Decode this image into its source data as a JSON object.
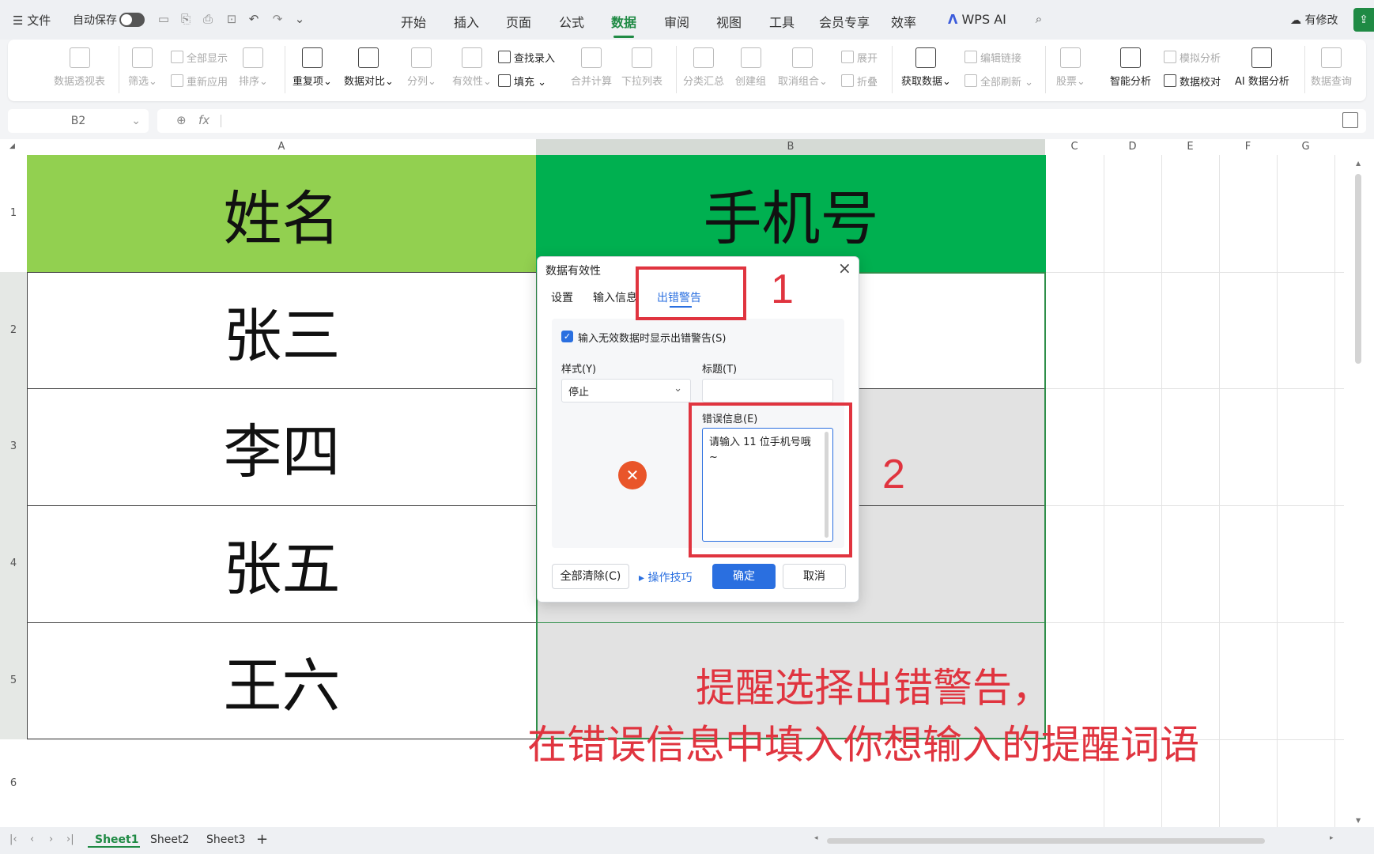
{
  "topbar": {
    "file_menu": "文件",
    "autosave_label": "自动保存",
    "menu_tabs": [
      "开始",
      "插入",
      "页面",
      "公式",
      "数据",
      "审阅",
      "视图",
      "工具",
      "会员专享",
      "效率",
      "WPS AI"
    ],
    "active_tab": "数据",
    "modify_label": "有修改"
  },
  "ribbon": {
    "pivot": "数据透视表",
    "filter": "筛选",
    "show_all": "全部显示",
    "reapply": "重新应用",
    "sort": "排序",
    "duplicates": "重复项",
    "compare": "数据对比",
    "split": "分列",
    "validity": "有效性",
    "find_entry": "查找录入",
    "fill": "填充",
    "consolidate": "合并计算",
    "dropdown": "下拉列表",
    "subtotal": "分类汇总",
    "group": "创建组",
    "ungroup": "取消组合",
    "expand": "展开",
    "collapse": "折叠",
    "get_data": "获取数据",
    "edit_links": "编辑链接",
    "refresh_all": "全部刷新",
    "stock": "股票",
    "what_if": "模拟分析",
    "smart_analysis": "智能分析",
    "data_check": "数据校对",
    "ai_analysis": "AI 数据分析",
    "data_query": "数据查询"
  },
  "formula_bar": {
    "cell_ref": "B2",
    "fx": "fx"
  },
  "grid": {
    "columns": [
      "A",
      "B",
      "C",
      "D",
      "E",
      "F",
      "G"
    ],
    "rows": [
      "1",
      "2",
      "3",
      "4",
      "5",
      "6"
    ],
    "header_a": "姓名",
    "header_b": "手机号",
    "names": [
      "张三",
      "李四",
      "张五",
      "王六"
    ]
  },
  "sheets": {
    "tabs": [
      "Sheet1",
      "Sheet2",
      "Sheet3"
    ],
    "active": "Sheet1",
    "add": "+"
  },
  "dialog": {
    "title": "数据有效性",
    "tabs": [
      "设置",
      "输入信息",
      "出错警告"
    ],
    "active_tab": "出错警告",
    "show_alert_checkbox": "输入无效数据时显示出错警告(S)",
    "show_alert_checked": true,
    "style_label": "样式(Y)",
    "style_value": "停止",
    "title_label": "标题(T)",
    "title_value": "",
    "error_label": "错误信息(E)",
    "error_value": "请输入 11 位手机号哦~",
    "clear_button": "全部清除(C)",
    "tips_link": "操作技巧",
    "ok_button": "确定",
    "cancel_button": "取消"
  },
  "annotations": {
    "num1": "1",
    "num2": "2",
    "line1": "提醒选择出错警告，",
    "line2": "在错误信息中填入你想输入的提醒词语"
  },
  "colors": {
    "header_a_bg": "#92d050",
    "header_b_bg": "#00b050",
    "annotation": "#e0343f",
    "accent": "#1f8a44",
    "primary_button": "#2a6fe0"
  }
}
